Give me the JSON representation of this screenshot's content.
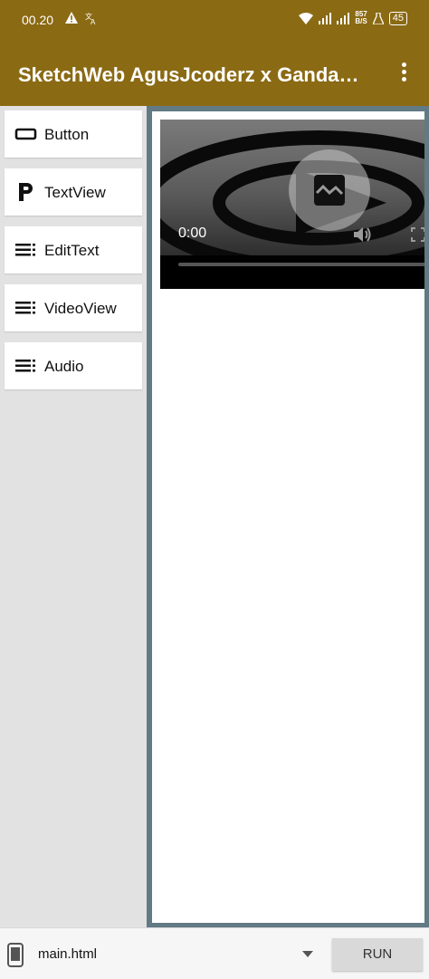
{
  "status_bar": {
    "time": "00.20",
    "net_speed_value": "857",
    "net_speed_unit": "B/S",
    "battery": "45"
  },
  "app_bar": {
    "title": "SketchWeb AgusJcoderz x GandaDev"
  },
  "palette": {
    "items": [
      {
        "label": "Button",
        "icon": "button-icon"
      },
      {
        "label": "TextView",
        "icon": "paragraph-icon"
      },
      {
        "label": "EditText",
        "icon": "list-lines-icon"
      },
      {
        "label": "VideoView",
        "icon": "list-lines-icon"
      },
      {
        "label": "Audio",
        "icon": "list-lines-icon"
      }
    ]
  },
  "canvas": {
    "video": {
      "time": "0:00"
    }
  },
  "bottom_bar": {
    "file_name": "main.html",
    "run_label": "RUN"
  },
  "colors": {
    "primary": "#8b6a14",
    "canvas_border": "#617a84",
    "palette_bg": "#e2e2e2"
  }
}
